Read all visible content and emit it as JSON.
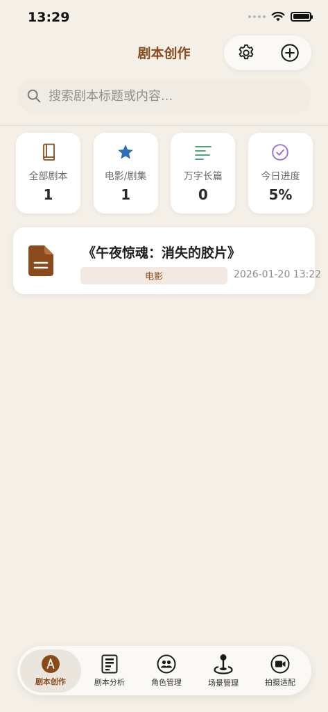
{
  "status_bar": {
    "time": "13:29"
  },
  "header": {
    "title": "剧本创作",
    "settings_icon": "gear-icon",
    "add_icon": "plus-circle-icon"
  },
  "search": {
    "placeholder": "搜索剧本标题或内容..."
  },
  "stats": [
    {
      "label": "全部剧本",
      "value": "1",
      "icon": "book-icon",
      "color": "#8a4a1c"
    },
    {
      "label": "电影/剧集",
      "value": "1",
      "icon": "star-icon",
      "color": "#2c6fb8"
    },
    {
      "label": "万字长篇",
      "value": "0",
      "icon": "text-lines-icon",
      "color": "#3a9a6a"
    },
    {
      "label": "今日进度",
      "value": "5%",
      "icon": "check-circle-icon",
      "color": "#9a72d6"
    }
  ],
  "scripts": [
    {
      "title": "《午夜惊魂：消失的胶片》",
      "tag": "电影",
      "date": "2026-01-20 13:22",
      "icon": "document-icon"
    }
  ],
  "tabs": [
    {
      "label": "剧本创作",
      "icon": "pen-nib-icon",
      "active": true
    },
    {
      "label": "剧本分析",
      "icon": "report-icon",
      "active": false
    },
    {
      "label": "角色管理",
      "icon": "people-icon",
      "active": false
    },
    {
      "label": "场景管理",
      "icon": "joystick-icon",
      "active": false
    },
    {
      "label": "拍摄适配",
      "icon": "camera-icon",
      "active": false
    }
  ],
  "colors": {
    "accent": "#8a4a1c",
    "background": "#f4f0e8",
    "card": "#ffffff"
  }
}
